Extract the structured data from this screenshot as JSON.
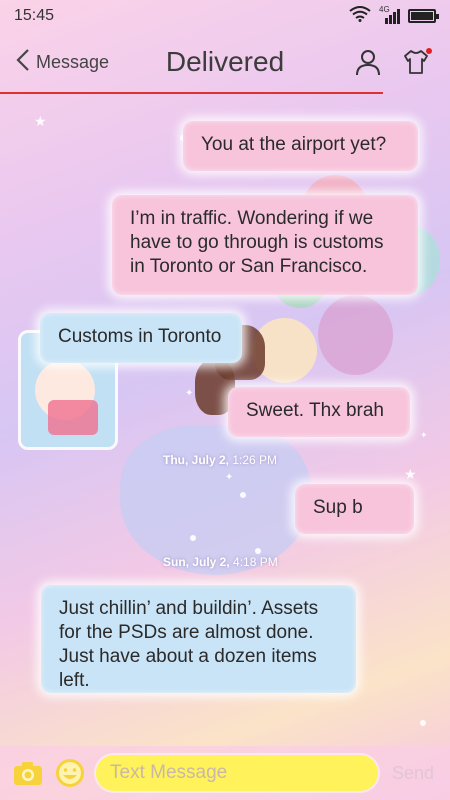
{
  "status_bar": {
    "time": "15:45",
    "network": "4G",
    "icons": [
      "wifi-icon",
      "signal-icon",
      "battery-icon"
    ]
  },
  "header": {
    "back_label": "Message",
    "title": "Delivered",
    "icons": [
      "contact-icon",
      "theme-shirt-icon"
    ]
  },
  "messages": [
    {
      "direction": "outgoing",
      "text": "You at the airport yet?"
    },
    {
      "direction": "outgoing",
      "text": "I’m in traffic. Wondering if we have to go through is customs in Toronto or San Francisco."
    },
    {
      "direction": "incoming",
      "text": "Customs in Toronto"
    },
    {
      "direction": "outgoing",
      "text": "Sweet. Thx brah"
    },
    {
      "direction": "outgoing",
      "text": "Sup b"
    },
    {
      "direction": "incoming",
      "text": "Just chillin’ and buildin’. Assets for the PSDs are almost done. Just have about a dozen items left."
    }
  ],
  "timestamps": [
    {
      "day": "Thu, July 2,",
      "time": "1:26 PM"
    },
    {
      "day": "Sun, July 2,",
      "time": "4:18 PM"
    }
  ],
  "composer": {
    "placeholder": "Text Message",
    "send_label": "Send",
    "icons": [
      "camera-icon",
      "emoji-icon"
    ]
  },
  "colors": {
    "accent_line": "#e03030",
    "outgoing_bubble": "#f7c4dc",
    "incoming_bubble": "#c9e4f6",
    "input_field": "#fff25a"
  }
}
